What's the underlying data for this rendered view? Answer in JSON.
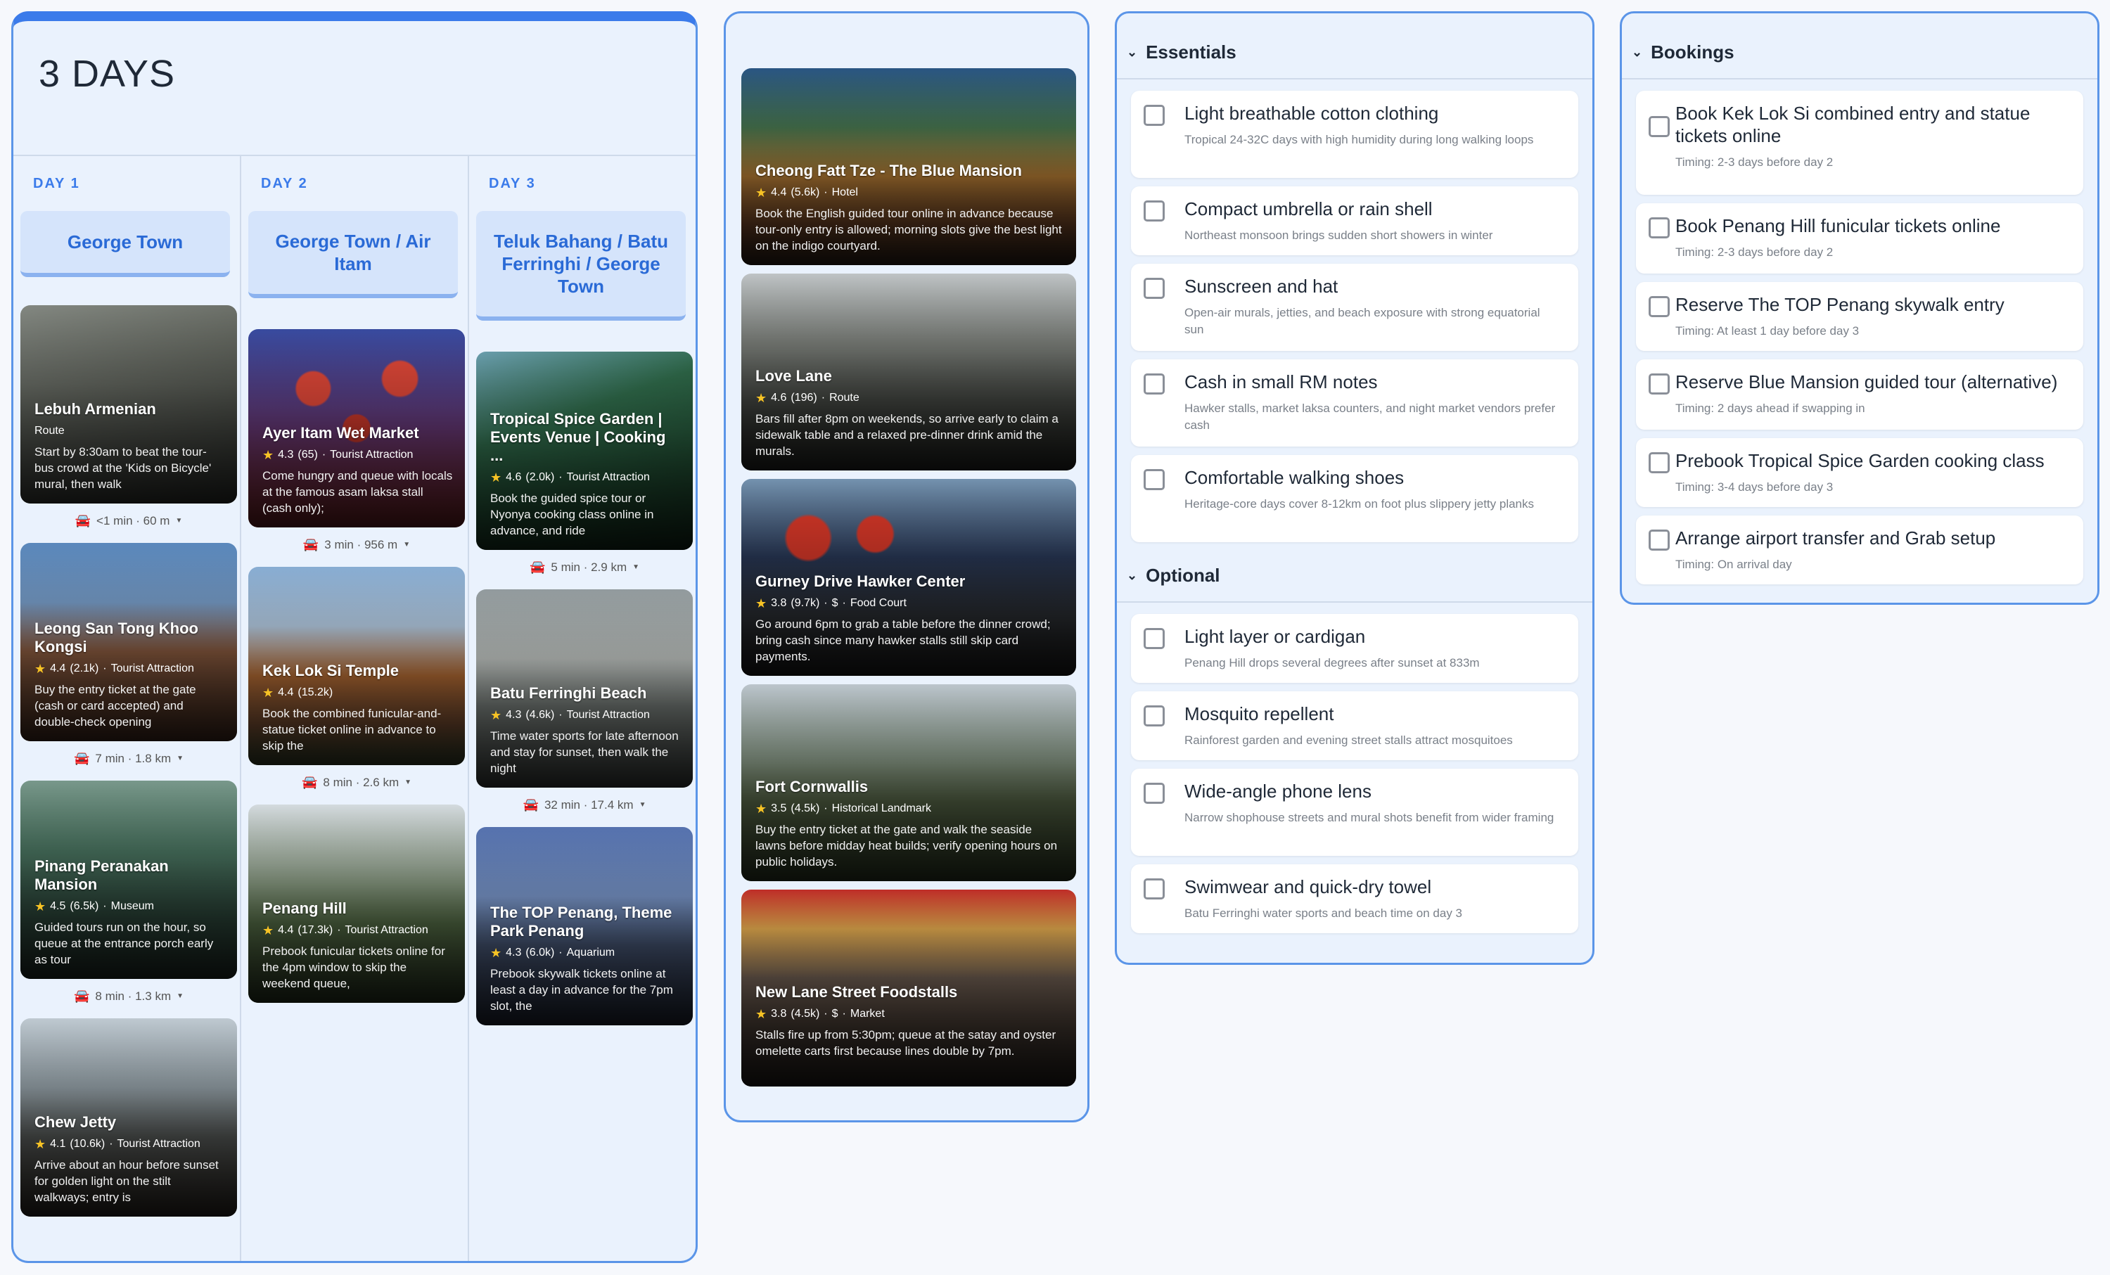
{
  "trip": {
    "title": "3 DAYS",
    "days": [
      {
        "label": "DAY 1",
        "area": "George Town",
        "stops": [
          {
            "name": "Lebuh Armenian",
            "rating": "",
            "reviews": "",
            "price": "",
            "category": "Route",
            "desc": "Start by 8:30am to beat the tour-bus crowd at the 'Kids on Bicycle' mural, then walk",
            "transit": "<1 min · 60 m"
          },
          {
            "name": "Leong San Tong Khoo Kongsi",
            "rating": "4.4",
            "reviews": "(2.1k)",
            "price": "",
            "category": "Tourist Attraction",
            "desc": "Buy the entry ticket at the gate (cash or card accepted) and double-check opening",
            "transit": "7 min · 1.8 km"
          },
          {
            "name": "Pinang Peranakan Mansion",
            "rating": "4.5",
            "reviews": "(6.5k)",
            "price": "",
            "category": "Museum",
            "desc": "Guided tours run on the hour, so queue at the entrance porch early as tour",
            "transit": "8 min · 1.3 km"
          },
          {
            "name": "Chew Jetty",
            "rating": "4.1",
            "reviews": "(10.6k)",
            "price": "",
            "category": "Tourist Attraction",
            "desc": "Arrive about an hour before sunset for golden light on the stilt walkways; entry is",
            "transit": ""
          }
        ]
      },
      {
        "label": "DAY 2",
        "area": "George Town / Air Itam",
        "stops": [
          {
            "name": "Ayer Itam Wet Market",
            "rating": "4.3",
            "reviews": "(65)",
            "price": "",
            "category": "Tourist Attraction",
            "desc": "Come hungry and queue with locals at the famous asam laksa stall (cash only);",
            "transit": "3 min · 956 m"
          },
          {
            "name": "Kek Lok Si Temple",
            "rating": "4.4",
            "reviews": "(15.2k)",
            "price": "",
            "category": "",
            "desc": "Book the combined funicular-and-statue ticket online in advance to skip the",
            "transit": "8 min · 2.6 km"
          },
          {
            "name": "Penang Hill",
            "rating": "4.4",
            "reviews": "(17.3k)",
            "price": "",
            "category": "Tourist Attraction",
            "desc": "Prebook funicular tickets online for the 4pm window to skip the weekend queue,",
            "transit": ""
          }
        ]
      },
      {
        "label": "DAY 3",
        "area": "Teluk Bahang / Batu Ferringhi / George Town",
        "stops": [
          {
            "name": "Tropical Spice Garden | Events Venue | Cooking ...",
            "rating": "4.6",
            "reviews": "(2.0k)",
            "price": "",
            "category": "Tourist Attraction",
            "desc": "Book the guided spice tour or Nyonya cooking class online in advance, and ride",
            "transit": "5 min · 2.9 km"
          },
          {
            "name": "Batu Ferringhi Beach",
            "rating": "4.3",
            "reviews": "(4.6k)",
            "price": "",
            "category": "Tourist Attraction",
            "desc": "Time water sports for late afternoon and stay for sunset, then walk the night",
            "transit": "32 min · 17.4 km"
          },
          {
            "name": "The TOP Penang, Theme Park Penang",
            "rating": "4.3",
            "reviews": "(6.0k)",
            "price": "",
            "category": "Aquarium",
            "desc": "Prebook skywalk tickets online at least a day in advance for the 7pm slot, the",
            "transit": ""
          }
        ]
      }
    ]
  },
  "places": [
    {
      "name": "Cheong Fatt Tze - The Blue Mansion",
      "rating": "4.4",
      "reviews": "(5.6k)",
      "price": "",
      "category": "Hotel",
      "desc": "Book the English guided tour online in advance because tour-only entry is allowed; morning slots give the best light on the indigo courtyard."
    },
    {
      "name": "Love Lane",
      "rating": "4.6",
      "reviews": "(196)",
      "price": "",
      "category": "Route",
      "desc": "Bars fill after 8pm on weekends, so arrive early to claim a sidewalk table and a relaxed pre-dinner drink amid the murals."
    },
    {
      "name": "Gurney Drive Hawker Center",
      "rating": "3.8",
      "reviews": "(9.7k)",
      "price": "$",
      "category": "Food Court",
      "desc": "Go around 6pm to grab a table before the dinner crowd; bring cash since many hawker stalls still skip card payments."
    },
    {
      "name": "Fort Cornwallis",
      "rating": "3.5",
      "reviews": "(4.5k)",
      "price": "",
      "category": "Historical Landmark",
      "desc": "Buy the entry ticket at the gate and walk the seaside lawns before midday heat builds; verify opening hours on public holidays."
    },
    {
      "name": "New Lane Street Foodstalls",
      "rating": "3.8",
      "reviews": "(4.5k)",
      "price": "$",
      "category": "Market",
      "desc": "Stalls fire up from 5:30pm; queue at the satay and oyster omelette carts first because lines double by 7pm."
    }
  ],
  "packing": {
    "essentials_title": "Essentials",
    "essentials": [
      {
        "title": "Light breathable cotton clothing",
        "sub": "Tropical 24-32C days with high humidity during long walking loops"
      },
      {
        "title": "Compact umbrella or rain shell",
        "sub": "Northeast monsoon brings sudden short showers in winter"
      },
      {
        "title": "Sunscreen and hat",
        "sub": "Open-air murals, jetties, and beach exposure with strong equatorial sun"
      },
      {
        "title": "Cash in small RM notes",
        "sub": "Hawker stalls, market laksa counters, and night market vendors prefer cash"
      },
      {
        "title": "Comfortable walking shoes",
        "sub": "Heritage-core days cover 8-12km on foot plus slippery jetty planks"
      }
    ],
    "optional_title": "Optional",
    "optional": [
      {
        "title": "Light layer or cardigan",
        "sub": "Penang Hill drops several degrees after sunset at 833m"
      },
      {
        "title": "Mosquito repellent",
        "sub": "Rainforest garden and evening street stalls attract mosquitoes"
      },
      {
        "title": "Wide-angle phone lens",
        "sub": "Narrow shophouse streets and mural shots benefit from wider framing"
      },
      {
        "title": "Swimwear and quick-dry towel",
        "sub": "Batu Ferringhi water sports and beach time on day 3"
      }
    ]
  },
  "bookings": {
    "title": "Bookings",
    "items": [
      {
        "title": "Book Kek Lok Si combined entry and statue tickets online",
        "sub": "Timing: 2-3 days before day 2"
      },
      {
        "title": "Book Penang Hill funicular tickets online",
        "sub": "Timing: 2-3 days before day 2"
      },
      {
        "title": "Reserve The TOP Penang skywalk entry",
        "sub": "Timing: At least 1 day before day 3"
      },
      {
        "title": "Reserve Blue Mansion guided tour (alternative)",
        "sub": "Timing: 2 days ahead if swapping in"
      },
      {
        "title": "Prebook Tropical Spice Garden cooking class",
        "sub": "Timing: 3-4 days before day 3"
      },
      {
        "title": "Arrange airport transfer and Grab setup",
        "sub": "Timing: On arrival day"
      }
    ]
  },
  "icons": {
    "star": "star-icon",
    "car": "car-icon",
    "chevron": "chevron-down-icon",
    "checkbox": "checkbox-icon"
  },
  "colors": {
    "accent": "#3b7bea",
    "panel_bg": "#eaf2fd",
    "area_chip": "#d5e4fb",
    "star": "#f7c325"
  }
}
